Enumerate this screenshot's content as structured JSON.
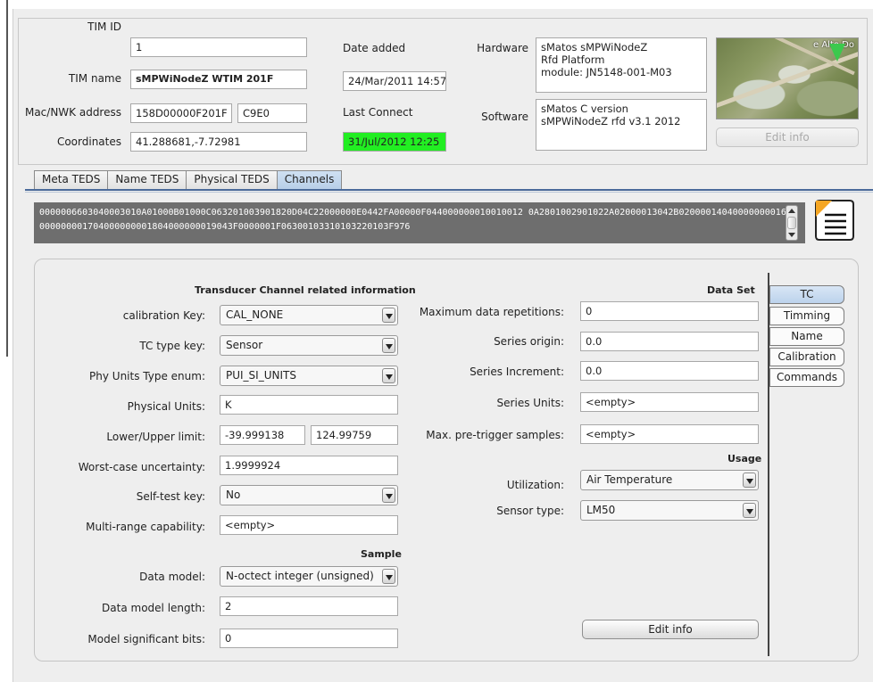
{
  "header": {
    "tim_id": {
      "label": "TIM ID",
      "value": "1"
    },
    "tim_name": {
      "label": "TIM name",
      "value": "sMPWiNodeZ  WTIM 201F"
    },
    "mac_nwk": {
      "label": "Mac/NWK address",
      "value1": "158D00000F201F",
      "value2": "C9E0"
    },
    "coordinates": {
      "label": "Coordinates",
      "value": "41.288681,-7.72981"
    },
    "date_added": {
      "label": "Date added",
      "value": "24/Mar/2011 14:57"
    },
    "last_connect": {
      "label": "Last Connect",
      "value": "31/Jul/2012 12:25"
    },
    "hardware": {
      "label": "Hardware",
      "value": "sMatos sMPWiNodeZ\nRfd Platform\nmodule: JN5148-001-M03"
    },
    "software": {
      "label": "Software",
      "value": "sMatos C version\nsMPWiNodeZ rfd v3.1 2012"
    },
    "map_label": "e Alto Do",
    "edit_info": "Edit info"
  },
  "tabs": [
    "Meta TEDS",
    "Name TEDS",
    "Physical TEDS",
    "Channels"
  ],
  "active_tab": "Channels",
  "raw_teds": "0000006603040003010A01000B01000C063201003901820D04C22000000E0442FA00000F044000000010010012 0A2801002901022A02000013042B0200001404000000001604000000001704000000001804000000019043F0000001F06300103310103220103F976",
  "channel": {
    "section_title": "Transducer Channel related information",
    "calibration_key": {
      "label": "calibration Key:",
      "value": "CAL_NONE"
    },
    "tc_type_key": {
      "label": "TC type key:",
      "value": "Sensor"
    },
    "phy_units_type": {
      "label": "Phy Units Type enum:",
      "value": "PUI_SI_UNITS"
    },
    "physical_units": {
      "label": "Physical Units:",
      "value": "K"
    },
    "limits": {
      "label": "Lower/Upper limit:",
      "lower": "-39.999138",
      "upper": "124.99759"
    },
    "worst_case": {
      "label": "Worst-case uncertainty:",
      "value": "1.9999924"
    },
    "self_test": {
      "label": "Self-test key:",
      "value": "No"
    },
    "multi_range": {
      "label": "Multi-range capability:",
      "value": "<empty>"
    },
    "sample_title": "Sample",
    "data_model": {
      "label": "Data model:",
      "value": "N-octect integer (unsigned)"
    },
    "data_model_length": {
      "label": "Data model length:",
      "value": "2"
    },
    "model_sig_bits": {
      "label": "Model significant bits:",
      "value": "0"
    }
  },
  "dataset": {
    "title": "Data Set",
    "max_repetitions": {
      "label": "Maximum data repetitions:",
      "value": "0"
    },
    "series_origin": {
      "label": "Series origin:",
      "value": "0.0"
    },
    "series_increment": {
      "label": "Series Increment:",
      "value": "0.0"
    },
    "series_units": {
      "label": "Series Units:",
      "value": "<empty>"
    },
    "max_pretrigger": {
      "label": "Max. pre-trigger samples:",
      "value": "<empty>"
    },
    "usage_title": "Usage",
    "utilization": {
      "label": "Utilization:",
      "value": "Air Temperature"
    },
    "sensor_type": {
      "label": "Sensor type:",
      "value": "LM50"
    },
    "edit_info": "Edit info"
  },
  "side_tabs": [
    "TC",
    "Timming",
    "Name",
    "Calibration",
    "Commands"
  ],
  "colors": {
    "last_connect_bg": "#22ee22",
    "active_tab": "#bcd2ec",
    "raw_bg": "#6e6e6e"
  }
}
